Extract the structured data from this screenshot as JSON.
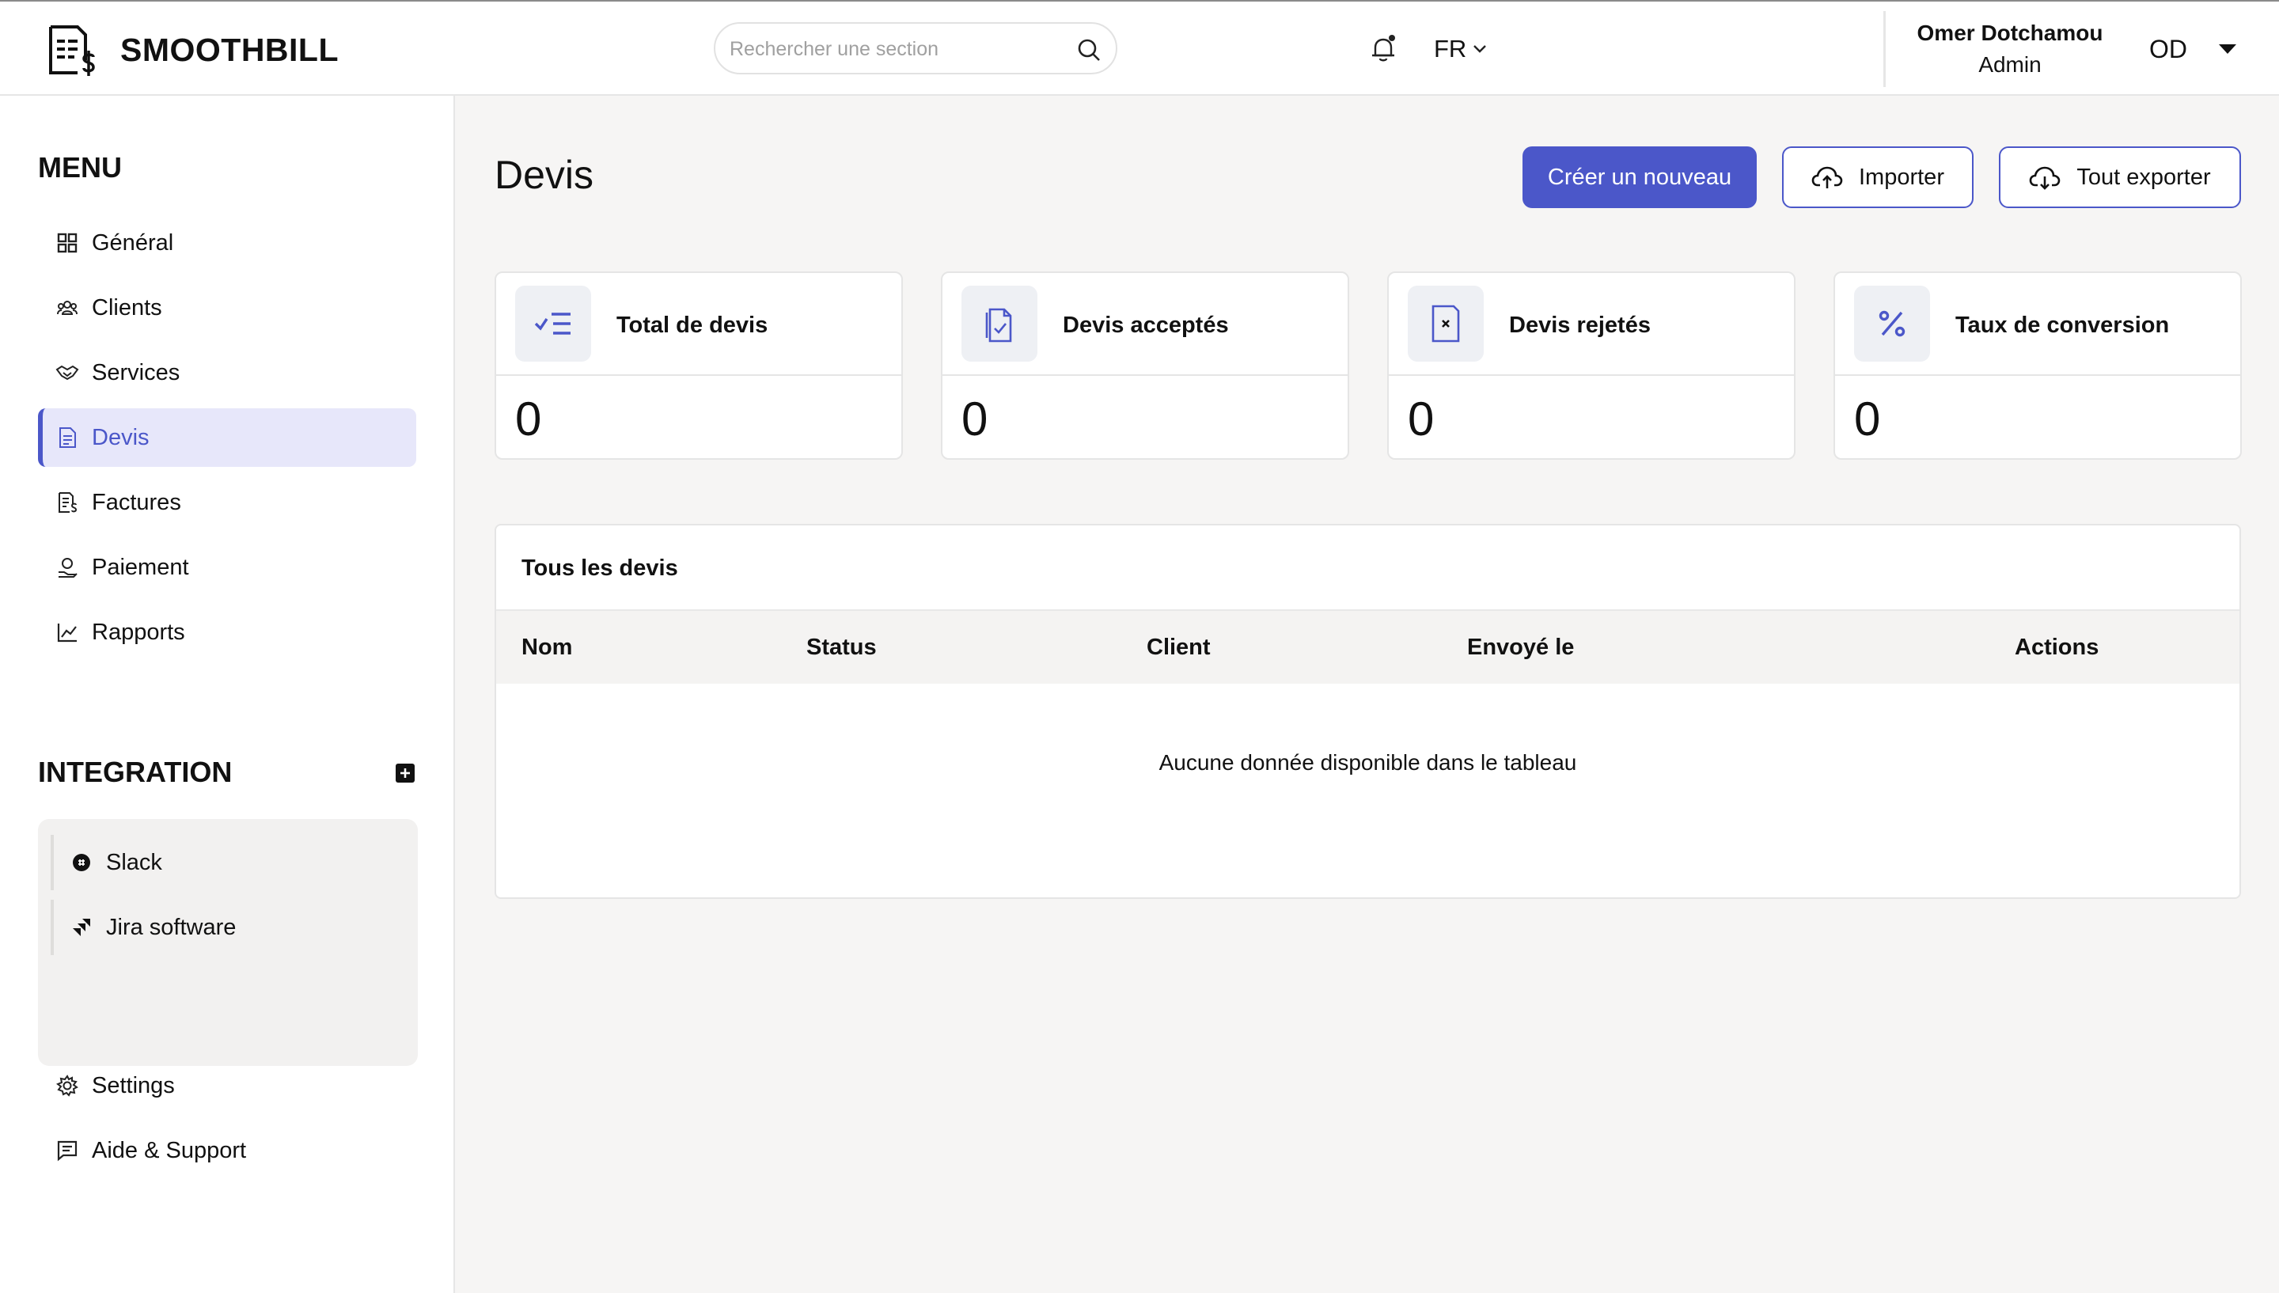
{
  "header": {
    "brand": "SMOOTHBILL",
    "search_placeholder": "Rechercher une section",
    "language": "FR",
    "user_name": "Omer Dotchamou",
    "user_role": "Admin",
    "user_initials": "OD"
  },
  "sidebar": {
    "menu_title": "MENU",
    "items": [
      {
        "label": "Général",
        "icon": "grid-icon"
      },
      {
        "label": "Clients",
        "icon": "users-icon"
      },
      {
        "label": "Services",
        "icon": "handshake-icon"
      },
      {
        "label": "Devis",
        "icon": "document-icon",
        "active": true
      },
      {
        "label": "Factures",
        "icon": "invoice-icon"
      },
      {
        "label": "Paiement",
        "icon": "payment-icon"
      },
      {
        "label": "Rapports",
        "icon": "chart-icon"
      }
    ],
    "integration_title": "INTEGRATION",
    "integrations": [
      {
        "label": "Slack",
        "icon": "slack-icon"
      },
      {
        "label": "Jira software",
        "icon": "jira-icon"
      }
    ],
    "bottom_items": [
      {
        "label": "Settings",
        "icon": "gear-icon"
      },
      {
        "label": "Aide & Support",
        "icon": "message-icon"
      }
    ]
  },
  "main": {
    "title": "Devis",
    "buttons": {
      "create": "Créer un nouveau",
      "import": "Importer",
      "export": "Tout exporter"
    },
    "stats": [
      {
        "label": "Total de devis",
        "value": "0"
      },
      {
        "label": "Devis acceptés",
        "value": "0"
      },
      {
        "label": "Devis rejetés",
        "value": "0"
      },
      {
        "label": "Taux de conversion",
        "value": "0"
      }
    ],
    "table": {
      "title": "Tous les devis",
      "columns": [
        "Nom",
        "Status",
        "Client",
        "Envoyé le",
        "Actions"
      ],
      "empty_message": "Aucune donnée disponible dans le tableau"
    }
  },
  "colors": {
    "accent": "#4b57c9",
    "active_bg": "#e7e7fa",
    "page_bg": "#f6f5f4"
  }
}
